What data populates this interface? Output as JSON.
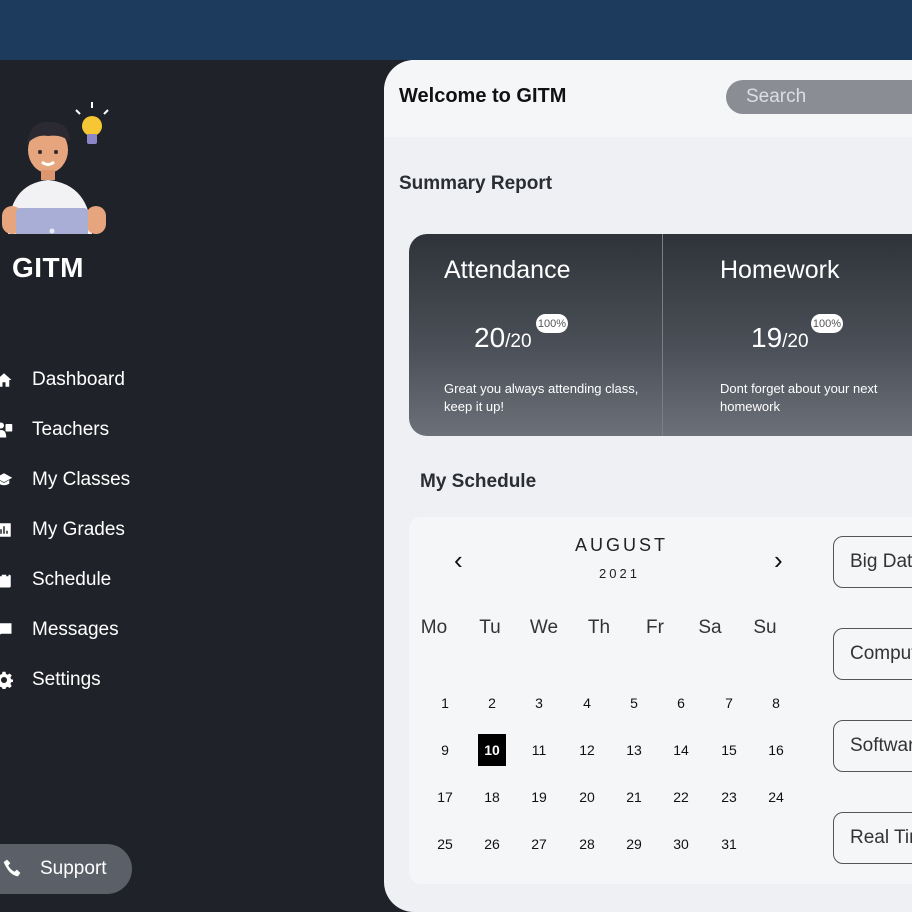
{
  "sidebar": {
    "brand": "GITM",
    "items": [
      {
        "label": "Dashboard",
        "icon": "home-icon"
      },
      {
        "label": "Teachers",
        "icon": "teachers-icon"
      },
      {
        "label": "My Classes",
        "icon": "graduation-cap-icon"
      },
      {
        "label": "My Grades",
        "icon": "chart-icon"
      },
      {
        "label": "Schedule",
        "icon": "calendar-icon"
      },
      {
        "label": "Messages",
        "icon": "message-icon"
      },
      {
        "label": "Settings",
        "icon": "gear-icon"
      }
    ],
    "support": {
      "label": "Support",
      "icon": "phone-icon"
    }
  },
  "header": {
    "welcome": "Welcome to GITM",
    "search_placeholder": "Search"
  },
  "summary": {
    "title": "Summary Report",
    "cards": [
      {
        "title": "Attendance",
        "value": "20",
        "total": "/20",
        "badge": "100%",
        "desc_line1": "Great you always attending class,",
        "desc_line2": "keep it up!"
      },
      {
        "title": "Homework",
        "value": "19",
        "total": "/20",
        "badge": "100%",
        "desc_line1": "Dont forget about your next",
        "desc_line2": "homework"
      }
    ]
  },
  "schedule": {
    "title": "My Schedule",
    "calendar": {
      "month": "AUGUST",
      "year": "2021",
      "prev": "‹",
      "next": "›",
      "weekdays": [
        "Mo",
        "Tu",
        "We",
        "Th",
        "Fr",
        "Sa",
        "Su"
      ],
      "selected_day": 10,
      "weeks": [
        [
          "1",
          "2",
          "3",
          "4",
          "5",
          "6",
          "7",
          "8"
        ],
        [
          "9",
          "10",
          "11",
          "12",
          "13",
          "14",
          "15",
          "16"
        ],
        [
          "17",
          "18",
          "19",
          "20",
          "21",
          "22",
          "23",
          "24"
        ],
        [
          "25",
          "26",
          "27",
          "28",
          "29",
          "30",
          "31"
        ]
      ]
    },
    "courses": [
      "Big Data",
      "Computer",
      "Software",
      "Real Time"
    ]
  },
  "colors": {
    "topbar": "#1d3b5c",
    "sidebar": "#1f2228",
    "main_bg": "#eef0f3",
    "card_gradient_top": "#2f3339",
    "card_gradient_bottom": "#6c7079",
    "support_bg": "#5b6068",
    "search_bg": "#8a8e94",
    "selected_day": "#000000"
  }
}
